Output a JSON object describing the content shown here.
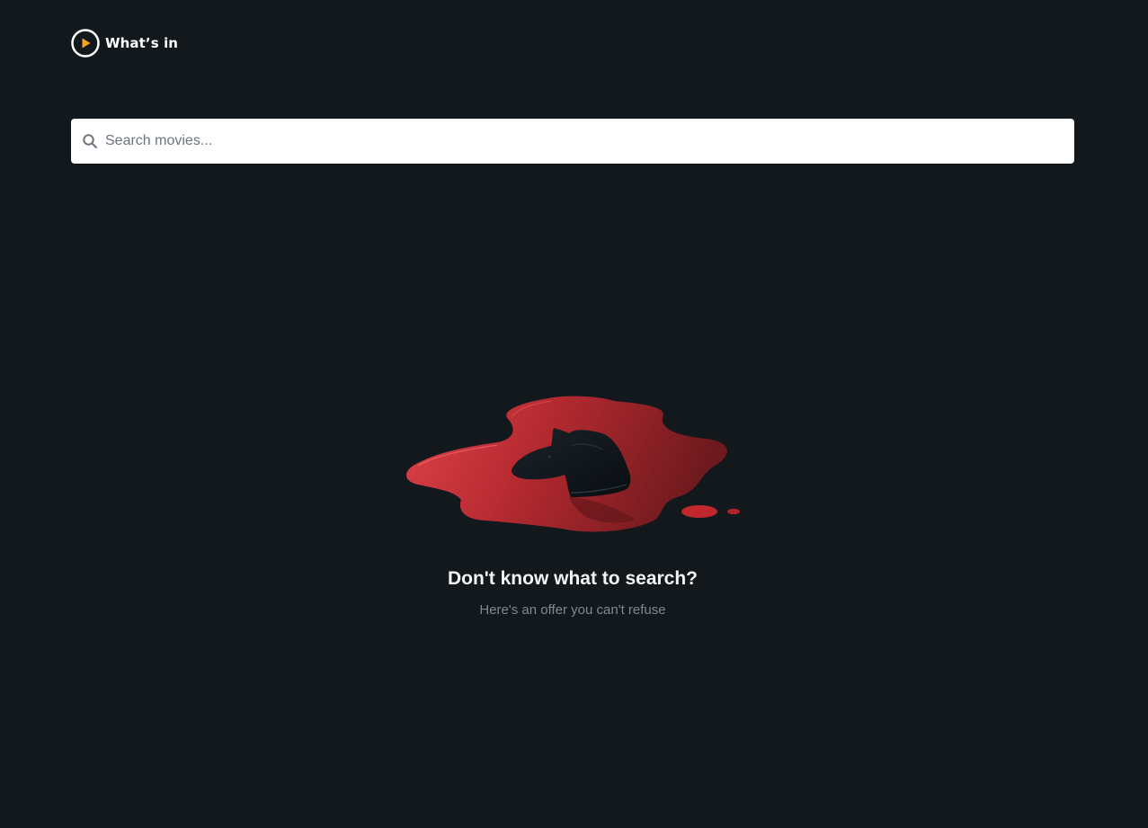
{
  "header": {
    "logo_icon": "play-circle-icon",
    "logo_text": "What’s in"
  },
  "search": {
    "icon": "search-icon",
    "placeholder": "Search movies...",
    "value": ""
  },
  "empty_state": {
    "illustration": "horse-head-in-blood-pool",
    "title": "Don't know what to search?",
    "subtitle": "Here's an offer you can't refuse"
  },
  "colors": {
    "background": "#13181c",
    "accent": "#f5a623",
    "blood": "#c0282e",
    "text_primary": "#f1f3f5",
    "text_secondary": "#7d8a94"
  }
}
